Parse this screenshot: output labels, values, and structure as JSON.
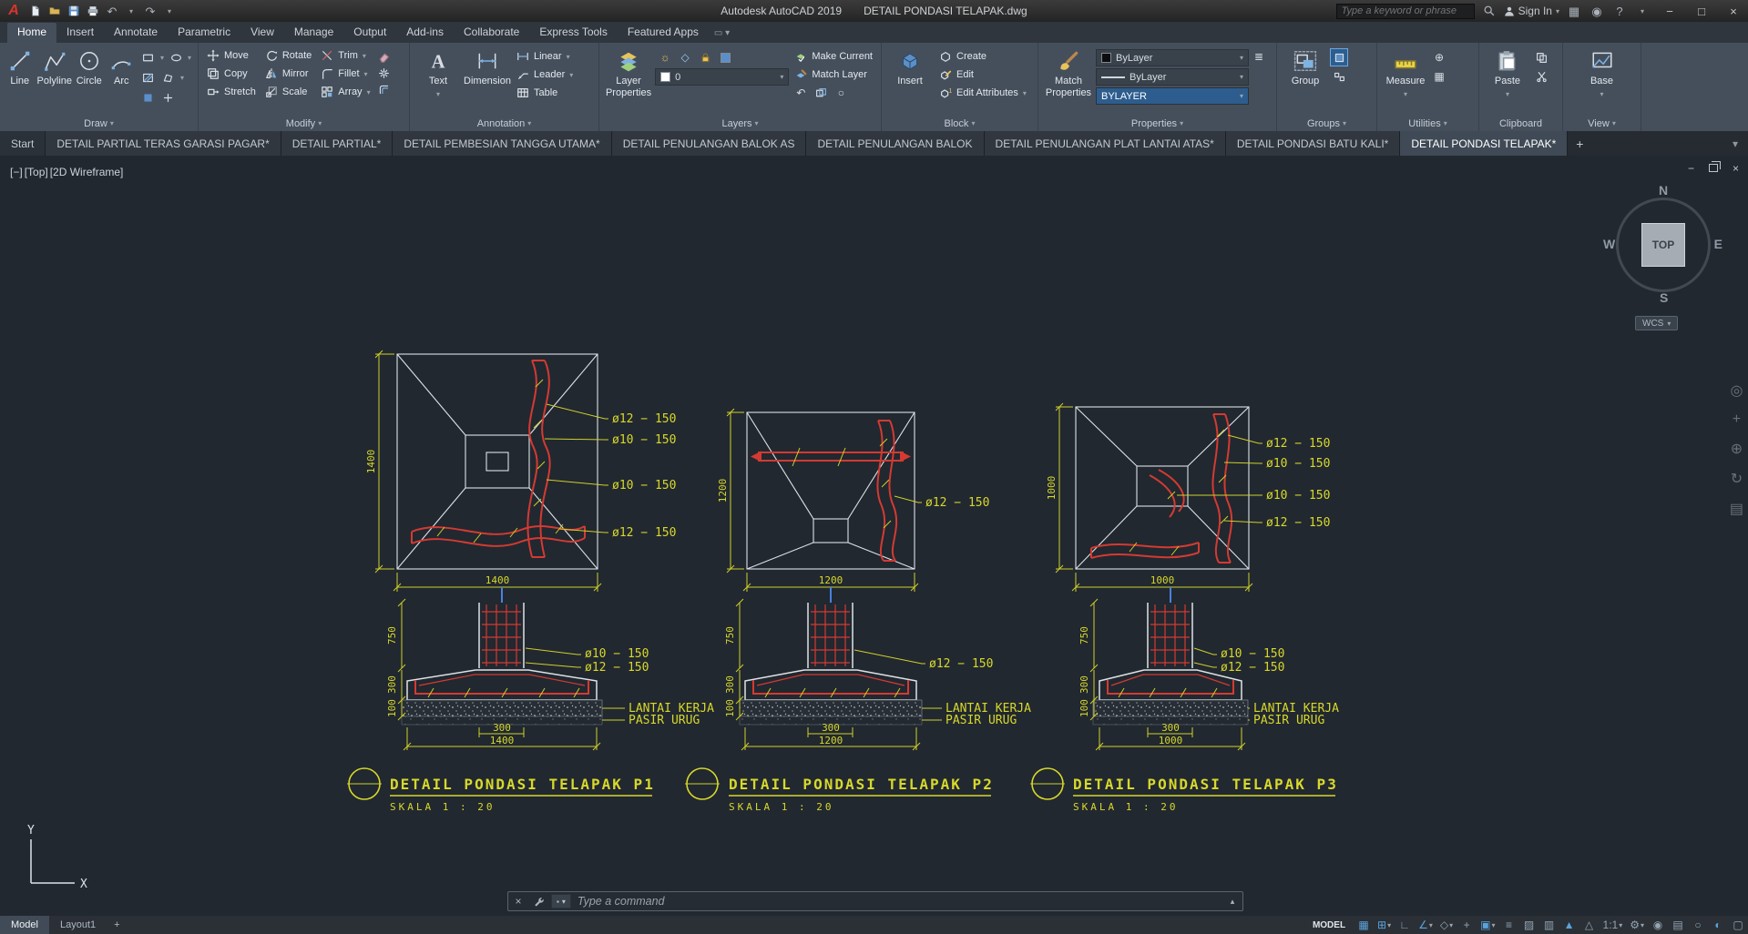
{
  "title_bar": {
    "app": "Autodesk AutoCAD 2019",
    "doc": "DETAIL PONDASI TELAPAK.dwg",
    "search_placeholder": "Type a keyword or phrase",
    "sign_in": "Sign In"
  },
  "icons": {
    "undo": "↶",
    "redo": "↷",
    "dropdown": "▾",
    "history_up": "▴",
    "minimize": "−",
    "maximize": "□",
    "close": "×",
    "help": "?",
    "apps": "▦",
    "connect": "◉",
    "plus": "+",
    "menu": "≡"
  },
  "ribbon_tabs": {
    "items": [
      "Home",
      "Insert",
      "Annotate",
      "Parametric",
      "View",
      "Manage",
      "Output",
      "Add-ins",
      "Collaborate",
      "Express Tools",
      "Featured Apps"
    ]
  },
  "ribbon": {
    "draw": {
      "label": "Draw",
      "line": "Line",
      "polyline": "Polyline",
      "circle": "Circle",
      "arc": "Arc"
    },
    "modify": {
      "label": "Modify",
      "move": "Move",
      "copy": "Copy",
      "stretch": "Stretch",
      "rotate": "Rotate",
      "mirror": "Mirror",
      "scale": "Scale",
      "trim": "Trim",
      "fillet": "Fillet",
      "array": "Array"
    },
    "annotation": {
      "label": "Annotation",
      "text": "Text",
      "dimension": "Dimension",
      "linear": "Linear",
      "leader": "Leader",
      "table": "Table"
    },
    "layers": {
      "label": "Layers",
      "layer_properties": "Layer Properties",
      "make_current": "Make Current",
      "match_layer": "Match Layer",
      "current_layer": "0"
    },
    "block": {
      "label": "Block",
      "insert": "Insert",
      "create": "Create",
      "edit": "Edit",
      "edit_attributes": "Edit Attributes"
    },
    "properties": {
      "label": "Properties",
      "match_properties": "Match Properties",
      "color": "ByLayer",
      "lineweight": "ByLayer",
      "linetype": "BYLAYER"
    },
    "groups": {
      "label": "Groups",
      "group": "Group"
    },
    "utilities": {
      "label": "Utilities",
      "measure": "Measure"
    },
    "clipboard": {
      "label": "Clipboard",
      "paste": "Paste"
    },
    "view": {
      "label": "View",
      "base": "Base"
    }
  },
  "file_tabs": {
    "items": [
      "Start",
      "DETAIL PARTIAL TERAS GARASI PAGAR*",
      "DETAIL PARTIAL*",
      "DETAIL PEMBESIAN TANGGA UTAMA*",
      "DETAIL PENULANGAN BALOK AS",
      "DETAIL PENULANGAN BALOK",
      "DETAIL PENULANGAN PLAT LANTAI ATAS*",
      "DETAIL PONDASI BATU KALI*",
      "DETAIL PONDASI TELAPAK*"
    ]
  },
  "viewport": {
    "controls_minus": "[−]",
    "controls_view": "[Top]",
    "controls_visual": "[2D Wireframe]",
    "wcs": "WCS",
    "viewcube": {
      "n": "N",
      "e": "E",
      "s": "S",
      "w": "W",
      "top": "TOP"
    },
    "nav": [
      {
        "name": "full-navigation-wheel",
        "glyph": "◎"
      },
      {
        "name": "pan",
        "glyph": "+"
      },
      {
        "name": "zoom",
        "glyph": "⊕"
      },
      {
        "name": "orbit",
        "glyph": "↻"
      },
      {
        "name": "show-motion",
        "glyph": "▤"
      }
    ]
  },
  "cad": {
    "p1": {
      "title": "DETAIL PONDASI TELAPAK P1",
      "scale": "SKALA 1 : 20",
      "plan_labels": [
        "ø12 − 150",
        "ø10 − 150",
        "ø10 − 150",
        "ø12 − 150"
      ],
      "plan_w": "1400",
      "plan_h": "1400",
      "section_labels": [
        "ø10 − 150",
        "ø12 − 150"
      ],
      "notes": [
        "LANTAI KERJA",
        "PASIR URUG"
      ],
      "ped_w": "300",
      "found_w": "1400",
      "side_dims": [
        "750",
        "300",
        "100"
      ]
    },
    "p2": {
      "title": "DETAIL PONDASI TELAPAK P2",
      "scale": "SKALA 1 : 20",
      "plan_labels": [
        "ø12 − 150"
      ],
      "plan_w": "1200",
      "plan_h": "1200",
      "section_labels": [
        "ø12 − 150"
      ],
      "notes": [
        "LANTAI KERJA",
        "PASIR URUG"
      ],
      "ped_w": "300",
      "found_w": "1200",
      "side_dims": [
        "750",
        "300",
        "100"
      ]
    },
    "p3": {
      "title": "DETAIL PONDASI TELAPAK P3",
      "scale": "SKALA 1 : 20",
      "plan_labels": [
        "ø12 − 150",
        "ø10 − 150",
        "ø10 − 150",
        "ø12 − 150"
      ],
      "plan_w": "1000",
      "plan_h": "1000",
      "section_labels": [
        "ø10 − 150",
        "ø12 − 150"
      ],
      "notes": [
        "LANTAI KERJA",
        "PASIR URUG"
      ],
      "ped_w": "300",
      "found_w": "1000",
      "side_dims": [
        "750",
        "300",
        "100"
      ]
    }
  },
  "command_line": {
    "placeholder": "Type a command"
  },
  "status_bar": {
    "model_tab": "Model",
    "layout_tab": "Layout1",
    "new_layout": "+",
    "model_space": "MODEL",
    "icons": [
      {
        "name": "grid",
        "glyph": "▦"
      },
      {
        "name": "snap",
        "glyph": "⊞"
      },
      {
        "name": "ortho",
        "glyph": "∟"
      },
      {
        "name": "polar-tracking",
        "glyph": "∠"
      },
      {
        "name": "isodraft",
        "glyph": "◇"
      },
      {
        "name": "object-snap-tracking",
        "glyph": "+"
      },
      {
        "name": "object-snap",
        "glyph": "▣"
      },
      {
        "name": "lineweight",
        "glyph": "≡"
      },
      {
        "name": "transparency",
        "glyph": "▨"
      },
      {
        "name": "selection-cycling",
        "glyph": "▥"
      },
      {
        "name": "annotation-visibility",
        "glyph": "▲"
      },
      {
        "name": "autoscale",
        "glyph": "△"
      },
      {
        "name": "annotation-scale",
        "glyph": "1:1"
      },
      {
        "name": "workspace",
        "glyph": "⚙"
      },
      {
        "name": "annotation-monitor",
        "glyph": "◉"
      },
      {
        "name": "quick-properties",
        "glyph": "▤"
      },
      {
        "name": "isolate-objects",
        "glyph": "○"
      },
      {
        "name": "graphics-performance",
        "glyph": "◐"
      },
      {
        "name": "clean-screen",
        "glyph": "▢"
      }
    ]
  }
}
